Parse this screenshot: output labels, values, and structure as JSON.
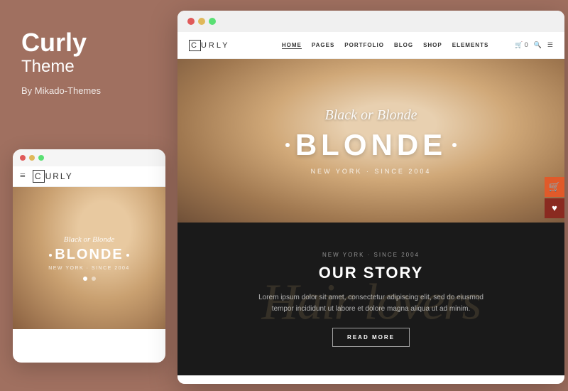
{
  "brand": {
    "title": "Curly",
    "subtitle": "Theme",
    "by": "By Mikado-Themes"
  },
  "mobile": {
    "logo_text": "CURLY",
    "logo_boxed_letter": "C",
    "hero_script": "Black or Blonde",
    "hero_main": "BLONDE",
    "hero_subtitle": "NEW YORK · SINCE 2004",
    "dots_count": 2
  },
  "desktop": {
    "logo_boxed_letter": "C",
    "logo_text": "URLY",
    "nav_links": [
      "HOME",
      "PAGES",
      "PORTFOLIO",
      "BLOG",
      "SHOP",
      "ELEMENTS"
    ],
    "active_nav": "HOME",
    "cart_label": "0",
    "hero_script": "Black or Blonde",
    "hero_main": "BLONDE",
    "hero_subtitle": "NEW YORK · SINCE 2004",
    "dark_section": {
      "location": "NEW YORK · SINCE 2004",
      "bg_text": "Hair lovers",
      "title": "OUR STORY",
      "body": "Lorem ipsum dolor sit amet, consectetur adipiscing elit, sed do eiusmod tempor incididunt ut labore et dolore magna aliqua ut ad minim.",
      "button_label": "READ MORE"
    }
  }
}
